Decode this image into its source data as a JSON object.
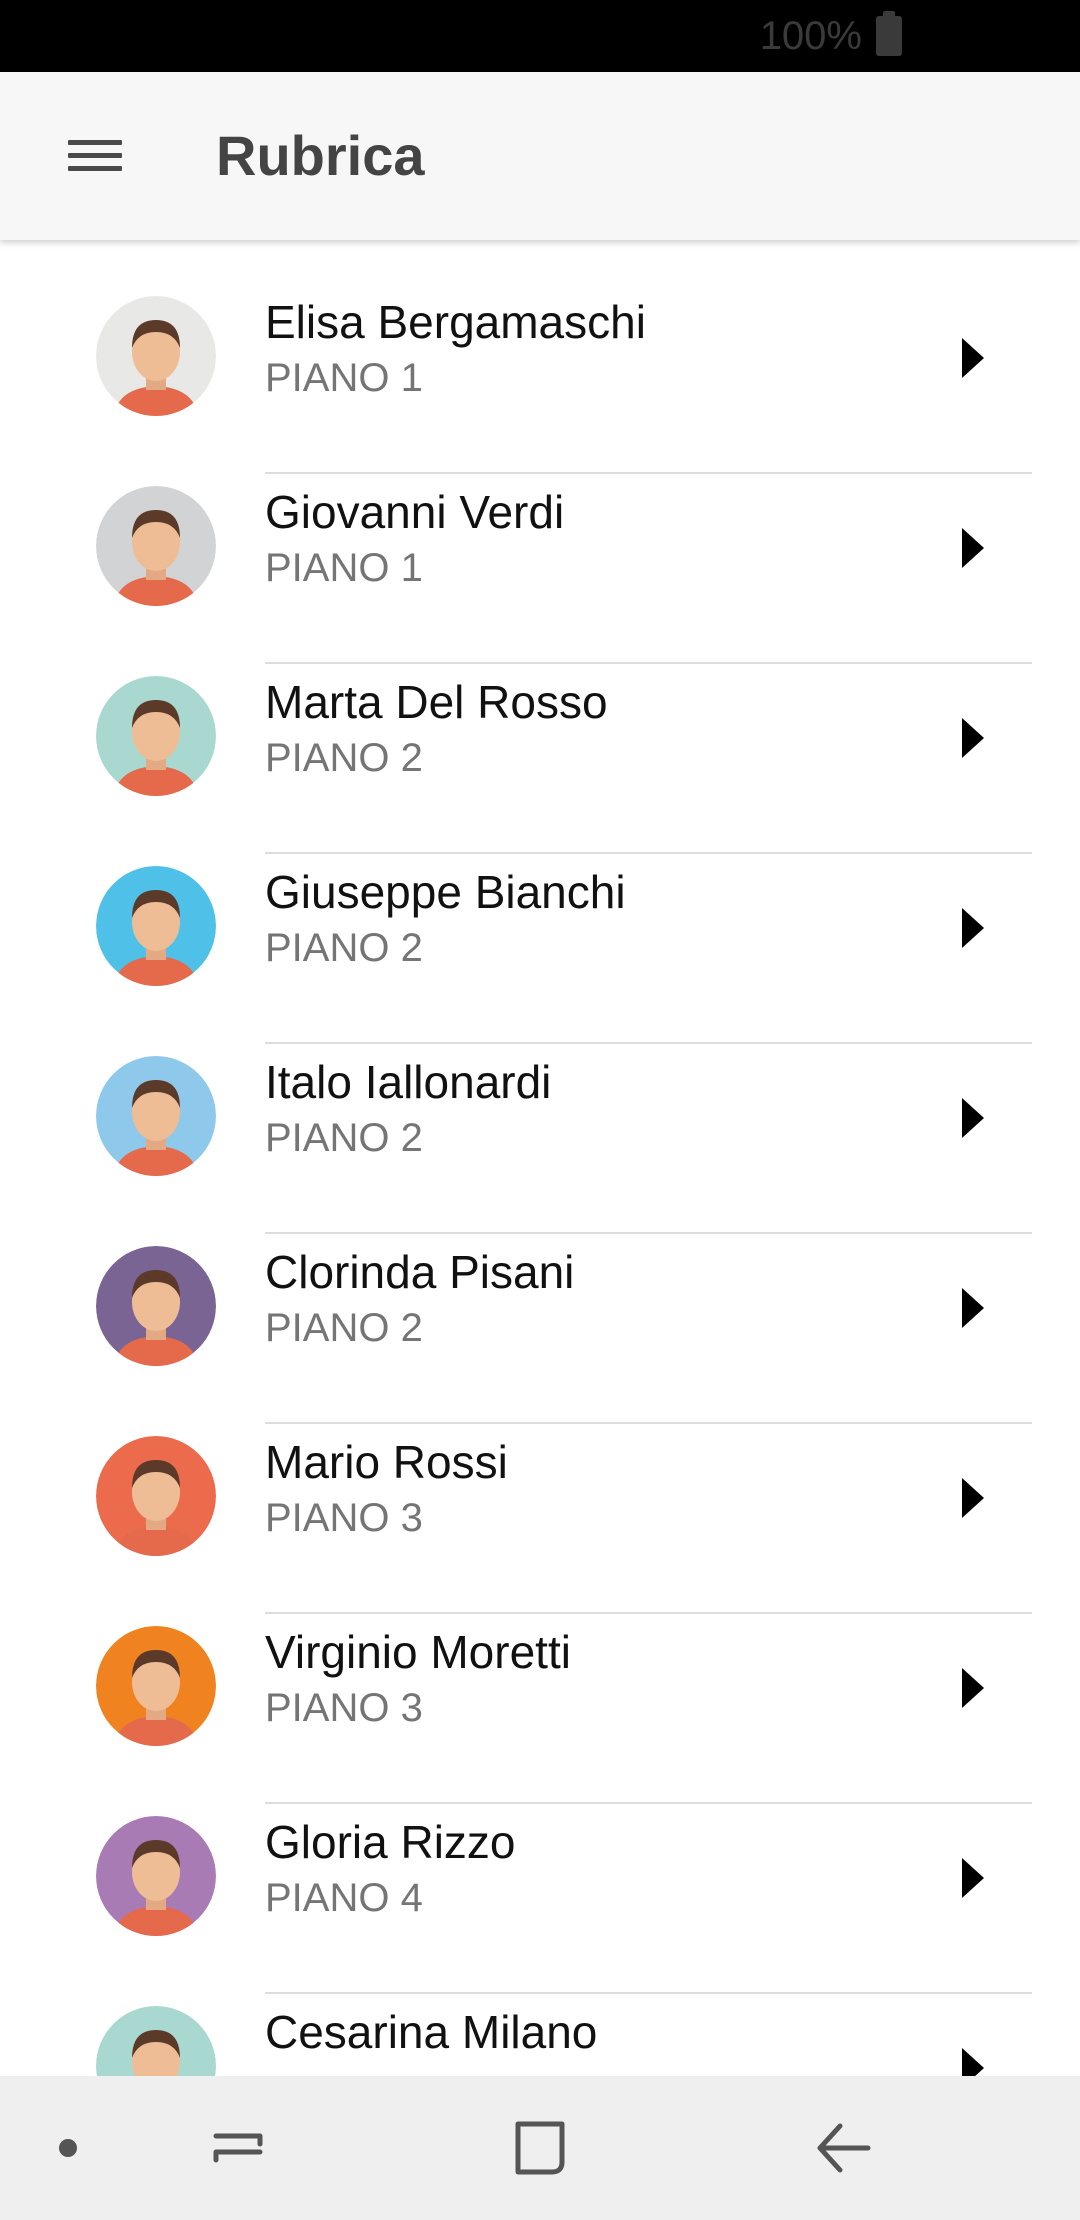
{
  "status_bar": {
    "battery_text": "100%"
  },
  "header": {
    "title": "Rubrica",
    "menu_icon": "hamburger-menu-icon"
  },
  "contacts": [
    {
      "name": "Elisa Bergamaschi",
      "floor": "PIANO 1",
      "avatar_bg": "#e8e8e6",
      "avatar": "woman-bun-avatar"
    },
    {
      "name": "Giovanni Verdi",
      "floor": "PIANO 1",
      "avatar_bg": "#d1d3d4",
      "avatar": "man-glasses-avatar"
    },
    {
      "name": "Marta Del Rosso",
      "floor": "PIANO 2",
      "avatar_bg": "#a8d8d0",
      "avatar": "woman-black-hair-avatar"
    },
    {
      "name": "Giuseppe Bianchi",
      "floor": "PIANO 2",
      "avatar_bg": "#4fc0e8",
      "avatar": "man-beard-avatar"
    },
    {
      "name": "Italo Iallonardi",
      "floor": "PIANO 2",
      "avatar_bg": "#8ec8ea",
      "avatar": "man-glasses-mustache-avatar"
    },
    {
      "name": "Clorinda Pisani",
      "floor": "PIANO 2",
      "avatar_bg": "#7a6494",
      "avatar": "woman-sunglasses-avatar"
    },
    {
      "name": "Mario Rossi",
      "floor": "PIANO 3",
      "avatar_bg": "#ec6b4c",
      "avatar": "man-beard-glasses-avatar"
    },
    {
      "name": "Virginio Moretti",
      "floor": "PIANO 3",
      "avatar_bg": "#f08220",
      "avatar": "man-glasses-bowtie-avatar"
    },
    {
      "name": "Gloria Rizzo",
      "floor": "PIANO 4",
      "avatar_bg": "#a97bb5",
      "avatar": "old-woman-avatar"
    },
    {
      "name": "Cesarina Milano",
      "floor": "",
      "avatar_bg": "#a8d8d0",
      "avatar": "woman-black-hair-avatar"
    }
  ],
  "row_action_icon": "chevron-right-icon",
  "nav_bar": {
    "items": [
      "dot-icon",
      "recents-icon",
      "home-icon",
      "back-icon"
    ]
  }
}
